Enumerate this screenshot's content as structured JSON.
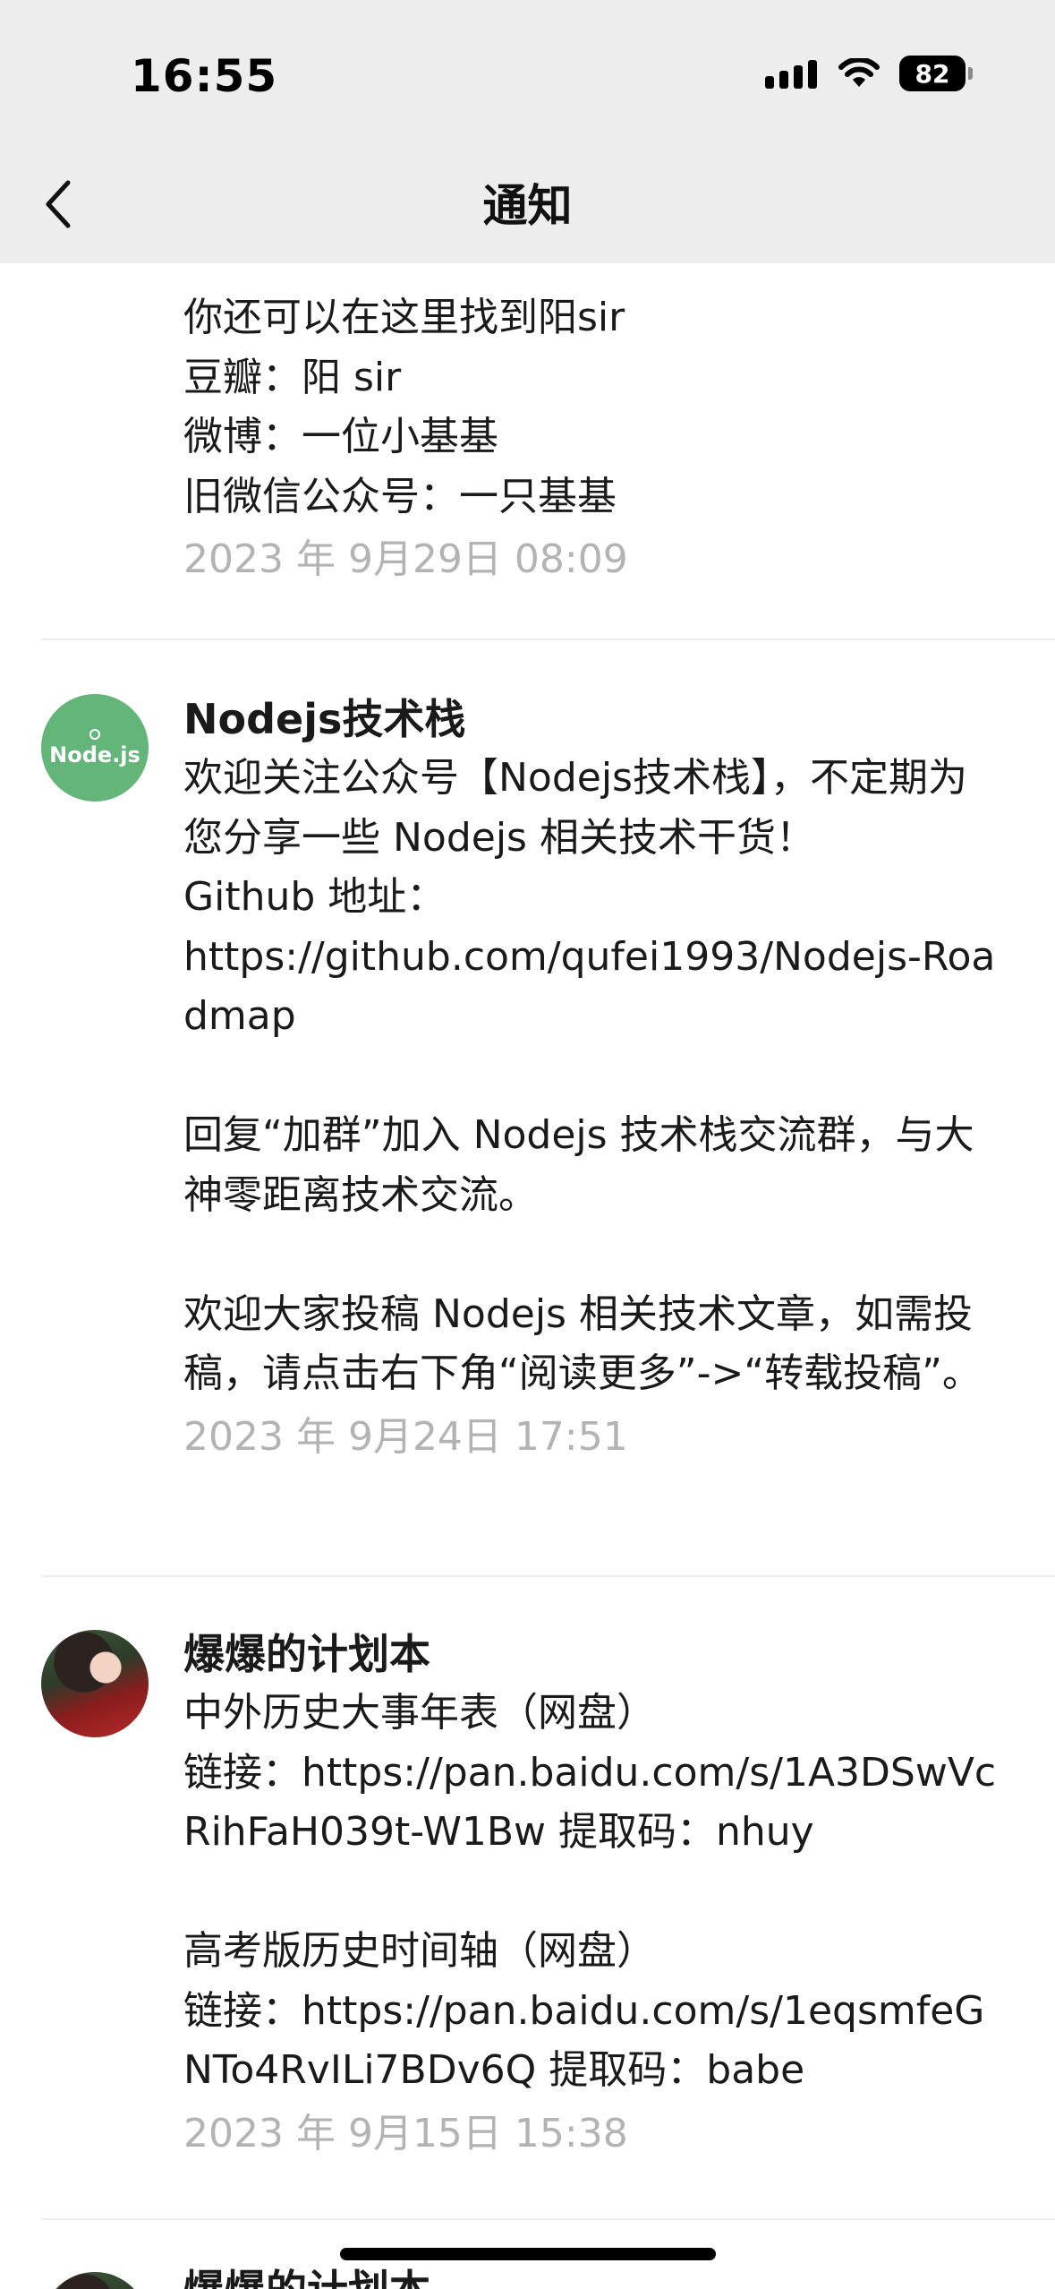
{
  "status": {
    "time": "16:55",
    "battery": "82"
  },
  "nav": {
    "title": "通知"
  },
  "messages": [
    {
      "name": "",
      "text": "你还可以在这里找到阳sir\n豆瓣：阳 sir\n微博：一位小基基\n旧微信公众号：一只基基",
      "date": "2023 年 9月29日 08:09"
    },
    {
      "name": "Nodejs技术栈",
      "avatar_text": "Node.js",
      "text": "欢迎关注公众号【Nodejs技术栈】，不定期为您分享一些 Nodejs 相关技术干货！\nGithub 地址：\nhttps://github.com/qufei1993/Nodejs-Roadmap\n\n回复“加群”加入 Nodejs 技术栈交流群，与大神零距离技术交流。\n\n欢迎大家投稿 Nodejs 相关技术文章，如需投稿，请点击右下角“阅读更多”->“转载投稿”。",
      "date": "2023 年 9月24日 17:51"
    },
    {
      "name": "爆爆的计划本",
      "text": "中外历史大事年表（网盘）\n链接：https://pan.baidu.com/s/1A3DSwVcRihFaH039t-W1Bw 提取码：nhuy\n\n高考版历史时间轴（网盘）\n链接：https://pan.baidu.com/s/1eqsmfeGNTo4RvILi7BDv6Q 提取码：babe",
      "date": "2023 年 9月15日 15:38"
    },
    {
      "name": "爆爆的计划本"
    }
  ]
}
